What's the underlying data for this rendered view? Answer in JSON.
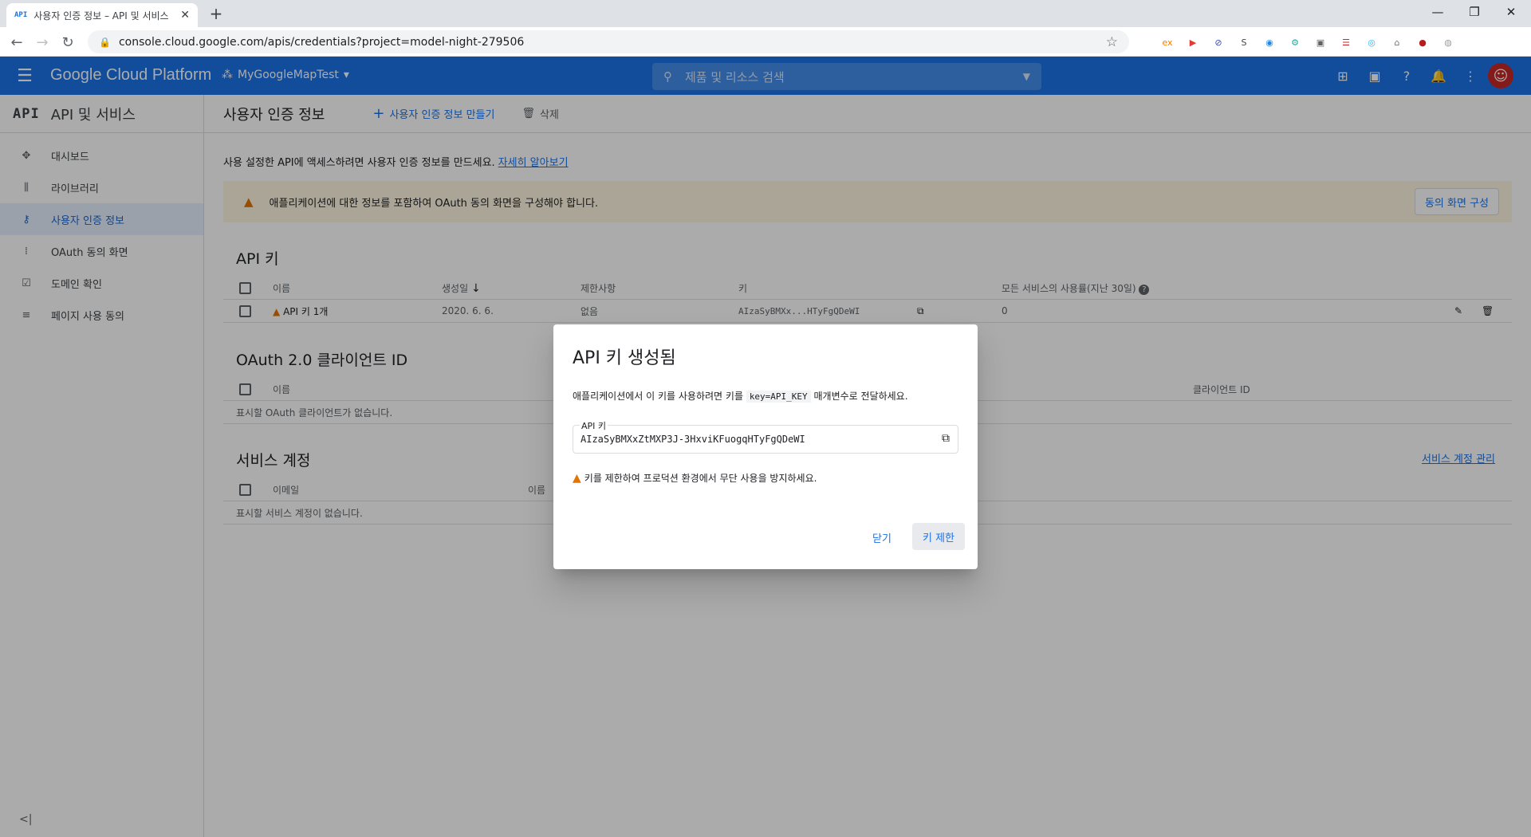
{
  "browser": {
    "tab_favicon": "API",
    "tab_title": "사용자 인증 정보 – API 및 서비스",
    "tab_close": "✕",
    "new_tab": "+",
    "url": "console.cloud.google.com/apis/credentials?project=model-night-279506",
    "extensions": [
      "ex",
      "▶",
      "⊘",
      "S",
      "◉",
      "⚙",
      "▣",
      "☰",
      "◎",
      "⌂",
      "●",
      "◍"
    ],
    "extension_colors": [
      "#f57c00",
      "#e53935",
      "#3949ab",
      "#424242",
      "#1e88e5",
      "#26a69a",
      "#616161",
      "#c62828",
      "#29b6f6",
      "#757575",
      "#b71c1c",
      "#9e9e9e"
    ]
  },
  "gcp": {
    "logo": "Google Cloud Platform",
    "project": "MyGoogleMapTest",
    "search_placeholder": "제품 및 리소스 검색"
  },
  "sidebar": {
    "section_icon": "API",
    "title": "API 및 서비스",
    "items": [
      {
        "label": "대시보드",
        "icon": "dashboard-icon",
        "glyph": "✥"
      },
      {
        "label": "라이브러리",
        "icon": "library-icon",
        "glyph": "⫼"
      },
      {
        "label": "사용자 인증 정보",
        "icon": "key-icon",
        "glyph": "⚷",
        "active": true
      },
      {
        "label": "OAuth 동의 화면",
        "icon": "consent-icon",
        "glyph": "⁞"
      },
      {
        "label": "도메인 확인",
        "icon": "domain-icon",
        "glyph": "☑"
      },
      {
        "label": "페이지 사용 동의",
        "icon": "page-settings-icon",
        "glyph": "≡"
      }
    ],
    "collapse": "<|"
  },
  "main": {
    "title": "사용자 인증 정보",
    "create_btn": "사용자 인증 정보 만들기",
    "delete_btn": "삭제",
    "intro": "사용 설정한 API에 액세스하려면 사용자 인증 정보를 만드세요.",
    "learn_more": "자세히 알아보기",
    "banner": "애플리케이션에 대한 정보를 포함하여 OAuth 동의 화면을 구성해야 합니다.",
    "consent_btn": "동의 화면 구성",
    "api_keys": {
      "title": "API 키",
      "headers": {
        "name": "이름",
        "created": "생성일",
        "restrictions": "제한사항",
        "key": "키",
        "usage": "모든 서비스의 사용률(지난 30일)"
      },
      "rows": [
        {
          "name": "API 키 1개",
          "created": "2020. 6. 6.",
          "restrictions": "없음",
          "key": "AIzaSyBMXx...HTyFgQDeWI",
          "usage": "0"
        }
      ]
    },
    "oauth": {
      "title": "OAuth 2.0 클라이언트 ID",
      "headers": {
        "name": "이름",
        "client_id": "클라이언트 ID"
      },
      "empty": "표시할 OAuth 클라이언트가 없습니다."
    },
    "service_accounts": {
      "title": "서비스 계정",
      "manage": "서비스 계정 관리",
      "headers": {
        "email": "이메일",
        "name": "이름"
      },
      "empty": "표시할 서비스 계정이 없습니다."
    }
  },
  "dialog": {
    "title": "API 키 생성됨",
    "desc_pre": "애플리케이션에서 이 키를 사용하려면 키를",
    "desc_code": "key=API_KEY",
    "desc_post": "매개변수로 전달하세요.",
    "key_label": "API 키",
    "key_value": "AIzaSyBMXxZtMXP3J-3HxviKFuogqHTyFgQDeWI",
    "warning": "키를 제한하여 프로덕션 환경에서 무단 사용을 방지하세요.",
    "close": "닫기",
    "restrict": "키 제한"
  }
}
